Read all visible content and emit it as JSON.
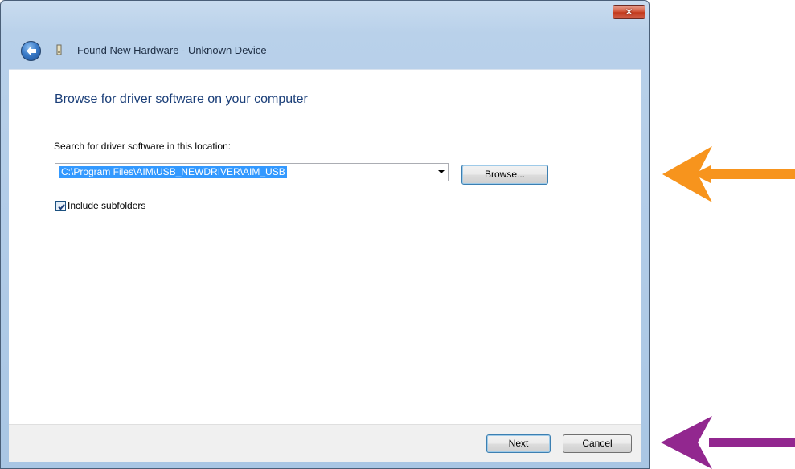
{
  "window": {
    "title": "Found New Hardware - Unknown Device",
    "close_label": "✕"
  },
  "content": {
    "heading": "Browse for driver software on your computer",
    "search_label": "Search for driver software in this location:",
    "path_value": "C:\\Program Files\\AIM\\USB_NEWDRIVER\\AIM_USB",
    "browse_label": "Browse...",
    "include_subfolders_label": "Include subfolders",
    "include_subfolders_checked": true
  },
  "footer": {
    "next_label": "Next",
    "cancel_label": "Cancel"
  },
  "annotations": {
    "arrow_1_color": "#f7941d",
    "arrow_2_color": "#92278f"
  }
}
